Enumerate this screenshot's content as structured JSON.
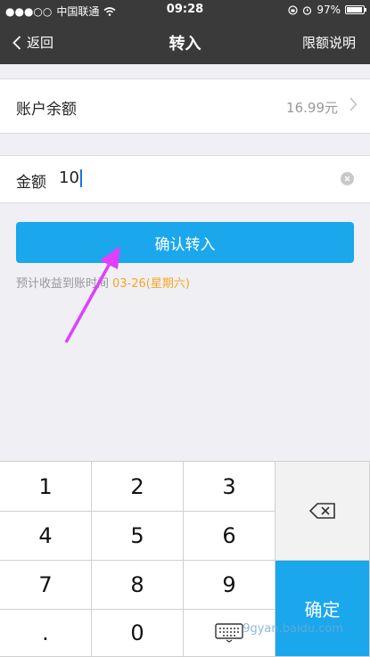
{
  "status_bar": {
    "carrier": "中国联通",
    "time": "09:28",
    "battery": "97%",
    "battery_level": 0.97
  },
  "nav": {
    "back_label": "返回",
    "title": "转入",
    "limit_label": "限额说明"
  },
  "balance": {
    "label": "账户余额",
    "value": "16.99元"
  },
  "amount": {
    "label": "金额",
    "value": "10"
  },
  "confirm_button": "确认转入",
  "eta": {
    "prefix": "预计收益到账时间",
    "date": "03-26(星期六)"
  },
  "keypad": {
    "k1": "1",
    "k2": "2",
    "k3": "3",
    "k4": "4",
    "k5": "5",
    "k6": "6",
    "k7": "7",
    "k8": "8",
    "k9": "9",
    "dot": ".",
    "k0": "0",
    "enter": "确定"
  },
  "watermark": "9gyan.baidu.com",
  "colors": {
    "accent": "#1aa7ec",
    "date": "#f5a623",
    "arrow": "#e040fb"
  },
  "icons": [
    "signal-dots-icon",
    "wifi-icon",
    "lock-rotation-icon",
    "alarm-icon",
    "battery-icon",
    "back-chevron-icon",
    "chevron-right-icon",
    "clear-icon",
    "backspace-icon",
    "keyboard-icon"
  ]
}
